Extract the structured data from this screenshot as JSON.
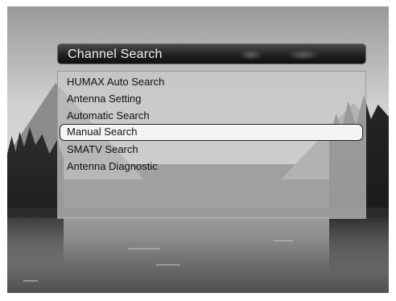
{
  "menu": {
    "title": "Channel Search",
    "items": [
      {
        "label": "HUMAX Auto Search",
        "selected": false
      },
      {
        "label": "Antenna Setting",
        "selected": false
      },
      {
        "label": "Automatic Search",
        "selected": false
      },
      {
        "label": "Manual Search",
        "selected": true
      },
      {
        "label": "SMATV Search",
        "selected": false
      },
      {
        "label": "Antenna Diagnostic",
        "selected": false
      }
    ]
  }
}
